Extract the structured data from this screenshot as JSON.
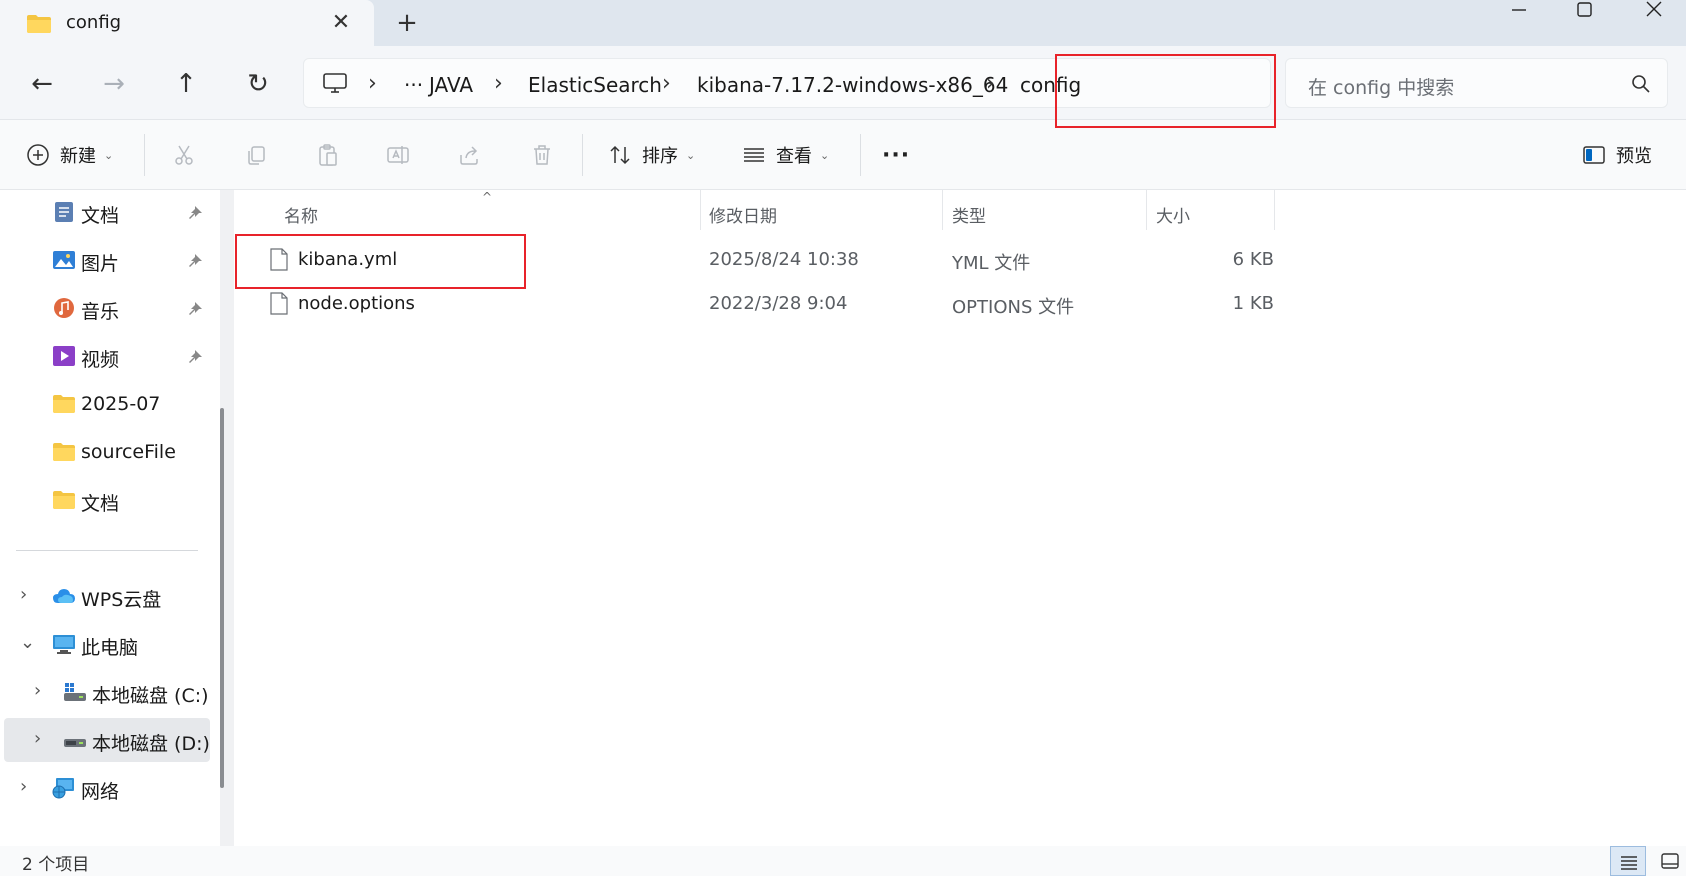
{
  "tab": {
    "title": "config",
    "close_glyph": "✕",
    "add_glyph": "+"
  },
  "window": {
    "minimize_glyph": "—",
    "maximize_glyph": "☐",
    "close_glyph": "✕"
  },
  "nav": {
    "back": "←",
    "forward": "→",
    "up": "↑",
    "refresh": "↻"
  },
  "breadcrumb": {
    "ellipsis": "···",
    "separator": "›",
    "items": [
      "JAVA",
      "ElasticSearch",
      "kibana-7.17.2-windows-x86_64",
      "config"
    ]
  },
  "search": {
    "placeholder": "在 config 中搜索"
  },
  "toolbar": {
    "new_label": "新建",
    "sort_label": "排序",
    "view_label": "查看",
    "more_label": "···",
    "preview_label": "预览",
    "caret": "⌄"
  },
  "sidebar": {
    "quick_access": [
      {
        "label": "文档",
        "icon": "documents-icon",
        "pinned": true
      },
      {
        "label": "图片",
        "icon": "pictures-icon",
        "pinned": true
      },
      {
        "label": "音乐",
        "icon": "music-icon",
        "pinned": true
      },
      {
        "label": "视频",
        "icon": "videos-icon",
        "pinned": true
      },
      {
        "label": "2025-07",
        "icon": "folder-icon",
        "pinned": false
      },
      {
        "label": "sourceFile",
        "icon": "folder-icon",
        "pinned": false
      },
      {
        "label": "文档",
        "icon": "folder-icon",
        "pinned": false
      }
    ],
    "tree": [
      {
        "label": "WPS云盘",
        "icon": "cloud-icon",
        "chevron": "›"
      },
      {
        "label": "此电脑",
        "icon": "computer-icon",
        "chevron": "⌄"
      },
      {
        "label": "本地磁盘 (C:)",
        "icon": "drive-c-icon",
        "chevron": "›"
      },
      {
        "label": "本地磁盘 (D:)",
        "icon": "drive-d-icon",
        "chevron": "›",
        "selected": true
      },
      {
        "label": "网络",
        "icon": "network-icon",
        "chevron": "›"
      }
    ]
  },
  "columns": {
    "name": "名称",
    "modified": "修改日期",
    "type": "类型",
    "size": "大小",
    "sort_glyph": "^"
  },
  "files": [
    {
      "name": "kibana.yml",
      "modified": "2025/8/24 10:38",
      "type": "YML 文件",
      "size": "6 KB"
    },
    {
      "name": "node.options",
      "modified": "2022/3/28 9:04",
      "type": "OPTIONS 文件",
      "size": "1 KB"
    }
  ],
  "status": {
    "item_count": "2 个项目"
  },
  "colors": {
    "accent": "#0067c0",
    "highlight": "#e8232a",
    "folder": "#f4c542"
  }
}
